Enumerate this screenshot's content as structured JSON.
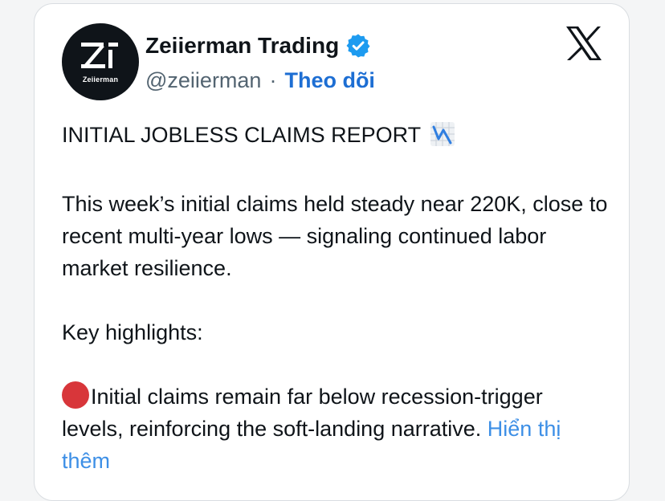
{
  "author": {
    "display_name": "Zeiierman Trading",
    "handle": "@zeiierman",
    "separator": "·",
    "follow_label": "Theo dõi",
    "avatar_text": "Zeiierman",
    "verified": true
  },
  "post": {
    "title": "INITIAL JOBLESS CLAIMS REPORT",
    "title_icon": "chart-decreasing-icon",
    "paragraph_1": "This week’s initial claims held steady near 220K, close to recent multi-year lows — signaling continued labor market resilience.",
    "paragraph_2": "Key highlights:",
    "highlight_icon": "red-circle-icon",
    "highlight_1": "Initial claims remain far below recession-trigger levels, reinforcing the soft-landing narrative.",
    "show_more_label": "Hiển thị thêm"
  },
  "colors": {
    "link": "#1d6ed3",
    "show_more": "#3d8fe6",
    "verified_badge": "#1d9bf0",
    "red_dot": "#d8363a",
    "text": "#0f1419",
    "secondary_text": "#536471"
  }
}
